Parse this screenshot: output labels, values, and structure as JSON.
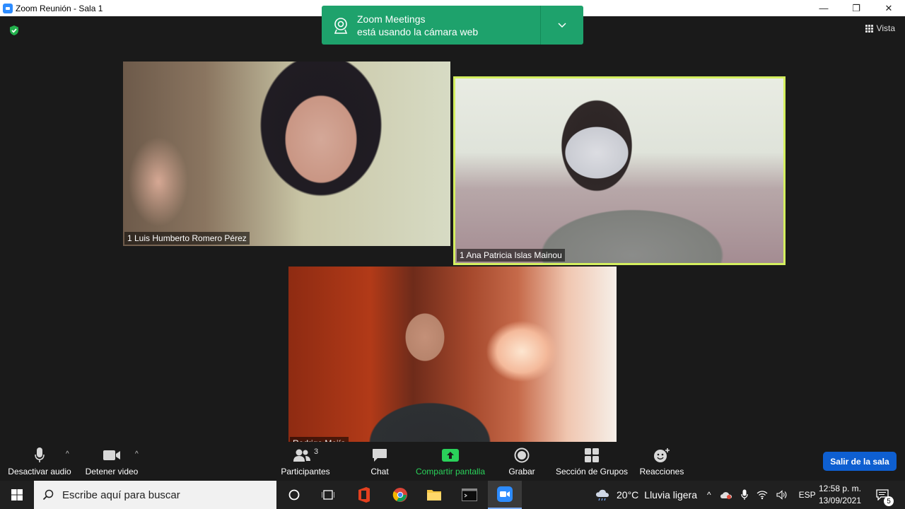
{
  "window": {
    "title": "Zoom Reunión - Sala 1",
    "minimize_glyph": "—",
    "restore_glyph": "❐",
    "close_glyph": "✕"
  },
  "top": {
    "view_label": "Vista"
  },
  "notification": {
    "line1": "Zoom Meetings",
    "line2": "está usando la cámara web"
  },
  "participants": [
    {
      "name": "1 Luis Humberto Romero Pérez",
      "active_speaker": false
    },
    {
      "name": "1 Ana Patricia Islas Mainou",
      "active_speaker": true
    },
    {
      "name": "Rodrigo Mejía",
      "active_speaker": false
    }
  ],
  "controls": {
    "mute_label": "Desactivar audio",
    "video_label": "Detener video",
    "participants_label": "Participantes",
    "participants_count": "3",
    "chat_label": "Chat",
    "share_label": "Compartir pantalla",
    "record_label": "Grabar",
    "breakout_label": "Sección de Grupos",
    "reactions_label": "Reacciones",
    "leave_label": "Salir de la sala"
  },
  "taskbar": {
    "search_placeholder": "Escribe aquí para buscar",
    "weather_temp": "20°C",
    "weather_desc": "Lluvia ligera",
    "language": "ESP",
    "time": "12:58 p. m.",
    "date": "13/09/2021",
    "notification_count": "5"
  },
  "colors": {
    "accent_green": "#2ad15a",
    "notification_green": "#1ea26c",
    "active_speaker_border": "#d4ef5f",
    "leave_button": "#0e5fd1"
  }
}
